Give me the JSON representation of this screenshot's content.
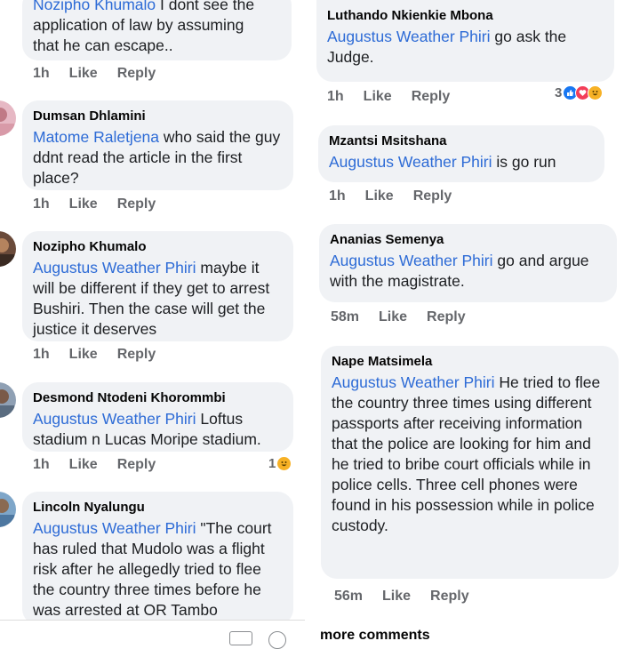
{
  "left": {
    "c0": {
      "author": "Nozipho Khumalo",
      "body_rest": " I dont see the",
      "line2": "application of law by assuming",
      "line3": "that he can escape..",
      "time": "1h",
      "like": "Like",
      "reply": "Reply"
    },
    "c1": {
      "author": "Dumsan Dhlamini",
      "mention": "Matome Raletjena",
      "text": " who said the guy ddnt read the article in the first place?",
      "time": "1h",
      "like": "Like",
      "reply": "Reply"
    },
    "c2": {
      "author": "Nozipho Khumalo",
      "mention": "Augustus Weather Phiri",
      "text": " maybe it will be different if they get to arrest Bushiri. Then the case will get the justice it deserves",
      "time": "1h",
      "like": "Like",
      "reply": "Reply"
    },
    "c3": {
      "author": "Desmond Ntodeni Khorommbi",
      "mention": "Augustus Weather Phiri",
      "text": " Loftus stadium n Lucas Moripe stadium.",
      "time": "1h",
      "like": "Like",
      "reply": "Reply",
      "reaction_count": "1"
    },
    "c4": {
      "author": "Lincoln Nyalungu",
      "mention": "Augustus Weather Phiri",
      "text": " \"The court has ruled that Mudolo was a flight risk after he allegedly tried to flee the country three times before he was arrested at OR Tambo"
    }
  },
  "right": {
    "c0": {
      "author": "Luthando Nkienkie Mbona",
      "mention": "Augustus Weather Phiri",
      "text": "  go ask the Judge.",
      "time": "1h",
      "like": "Like",
      "reply": "Reply",
      "reaction_count": "3"
    },
    "c1": {
      "author": "Mzantsi Msitshana",
      "mention": "Augustus Weather Phiri",
      "text": " is go run",
      "time": "1h",
      "like": "Like",
      "reply": "Reply"
    },
    "c2": {
      "author": "Ananias Semenya",
      "mention": "Augustus Weather Phiri",
      "text": " go and argue with the magistrate.",
      "time": "58m",
      "like": "Like",
      "reply": "Reply"
    },
    "c3": {
      "author": "Nape Matsimela",
      "mention": "Augustus Weather Phiri",
      "text": " He tried to flee the country three times using different passports after receiving information that the police are looking for him and he tried to bribe court officials while in police cells. Three cell phones were found in his possession while in police custody.",
      "time": "56m",
      "like": "Like",
      "reply": "Reply"
    },
    "more": "more comments"
  },
  "colors": {
    "bubble": "#f0f2f5",
    "mention": "#2d6bd6",
    "meta": "#65676b"
  },
  "icons": {
    "reactions": [
      "like-icon",
      "love-icon",
      "haha-icon"
    ]
  }
}
